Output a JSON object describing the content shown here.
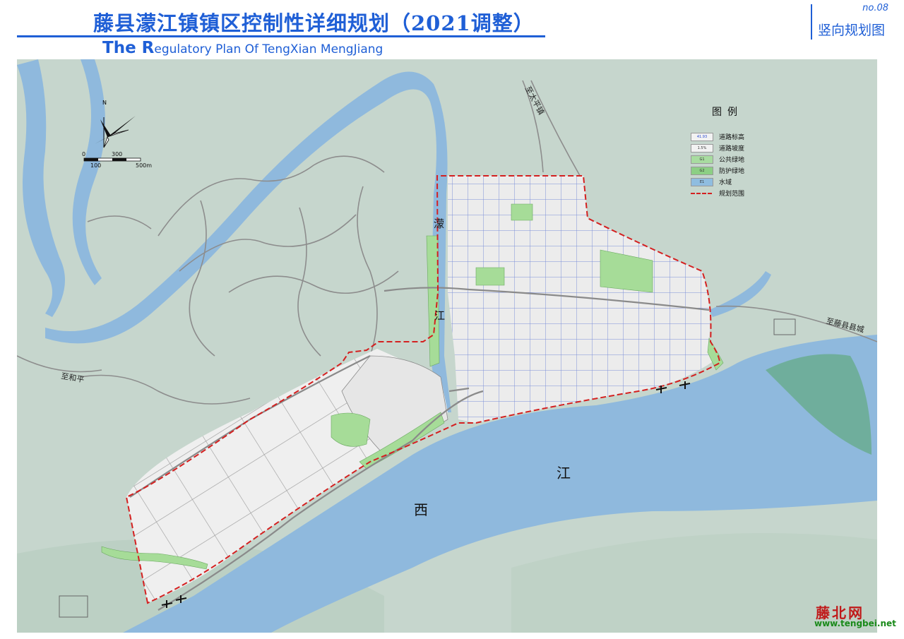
{
  "header": {
    "title_cn": "藤县濛江镇镇区控制性详细规划（2021调整）",
    "title_en_T": "The R",
    "title_en_rest": "egulatory Plan  Of  TengXian MengJiang",
    "sheet_no": "no.08",
    "sheet_name": "竖向规划图"
  },
  "map": {
    "compass_label": "N",
    "scale": {
      "labels": [
        "0",
        "300",
        "100",
        "500m"
      ]
    },
    "river_labels": {
      "xi": "西",
      "jiang": "江",
      "meng": "濛",
      "jiang_small": "江"
    },
    "road_labels": {
      "to_taiping": "至太平镇",
      "to_tengxian": "至藤县县城",
      "to_heping": "至和平"
    },
    "legend": {
      "title": "图例",
      "items": [
        {
          "swatch_text": "41.93",
          "label": "道路标高",
          "color": "#f2f2f2"
        },
        {
          "swatch_text": "1.5%",
          "label": "道路坡度",
          "color": "#f2f2f2"
        },
        {
          "swatch_text": "G1",
          "label": "公共绿地",
          "color": "#a8dca0"
        },
        {
          "swatch_text": "G2",
          "label": "防护绿地",
          "color": "#8ccf84"
        },
        {
          "swatch_text": "E1",
          "label": "水域",
          "color": "#8fbde0"
        },
        {
          "swatch_text": "",
          "label": "规划范围",
          "color": "#d42020"
        }
      ]
    },
    "colors": {
      "water": "#8fb9dd",
      "terrain": "#c6d6cd",
      "urban": "#eeeeee",
      "green": "#a6dc98",
      "boundary": "#d42020",
      "road": "#8a8a8a",
      "blue_grid": "#7d8fd8"
    }
  },
  "brand": {
    "name": "藤北网",
    "url": "www.tengbei.net"
  }
}
